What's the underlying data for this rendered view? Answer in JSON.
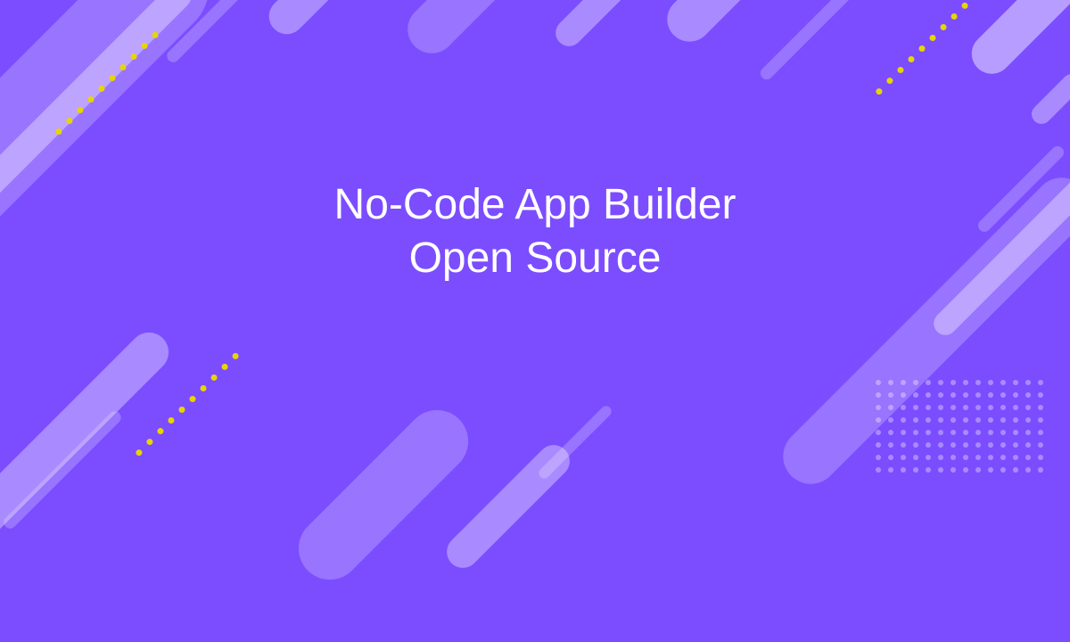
{
  "hero": {
    "line1": "No-Code App Builder",
    "line2": "Open Source"
  },
  "colors": {
    "background": "#7C4DFF",
    "shapes_light": "rgba(255,255,255,0.28)",
    "dots_yellow": "#E8D400",
    "text": "#ffffff"
  }
}
